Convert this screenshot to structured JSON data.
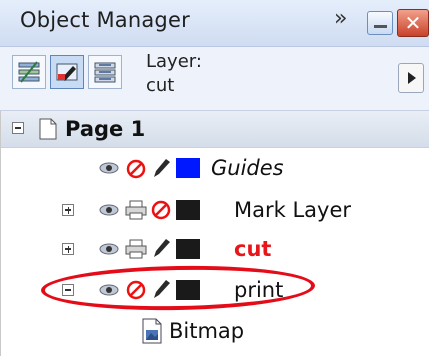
{
  "window": {
    "title": "Object Manager",
    "chevron": "»",
    "close_glyph": "✕"
  },
  "toolbar": {
    "layer_label": "Layer:",
    "layer_value": "cut",
    "buttons": [
      "show-object-properties-icon",
      "edit-across-layers-icon",
      "layer-manager-view-icon"
    ]
  },
  "tree": {
    "page": {
      "label": "Page 1",
      "expanded": true
    },
    "layers": [
      {
        "name": "Guides",
        "italic": true,
        "color": "#0018ff",
        "printable": false,
        "expandable": false
      },
      {
        "name": "Mark Layer",
        "italic": false,
        "color": "#1a1a1a",
        "printable": true,
        "editable_disabled": true,
        "expandable": true,
        "expanded": false
      },
      {
        "name": "cut",
        "italic": false,
        "bold": true,
        "text_color": "#e8161a",
        "color": "#1a1a1a",
        "printable": true,
        "expandable": true,
        "expanded": false
      },
      {
        "name": "print",
        "italic": false,
        "color": "#1a1a1a",
        "printable": false,
        "expandable": true,
        "expanded": true
      }
    ],
    "child": {
      "name": "Bitmap"
    }
  },
  "colors": {
    "highlight_ellipse": "#e30c18",
    "active_layer_text": "#e8161a",
    "guides_swatch": "#0018ff"
  }
}
